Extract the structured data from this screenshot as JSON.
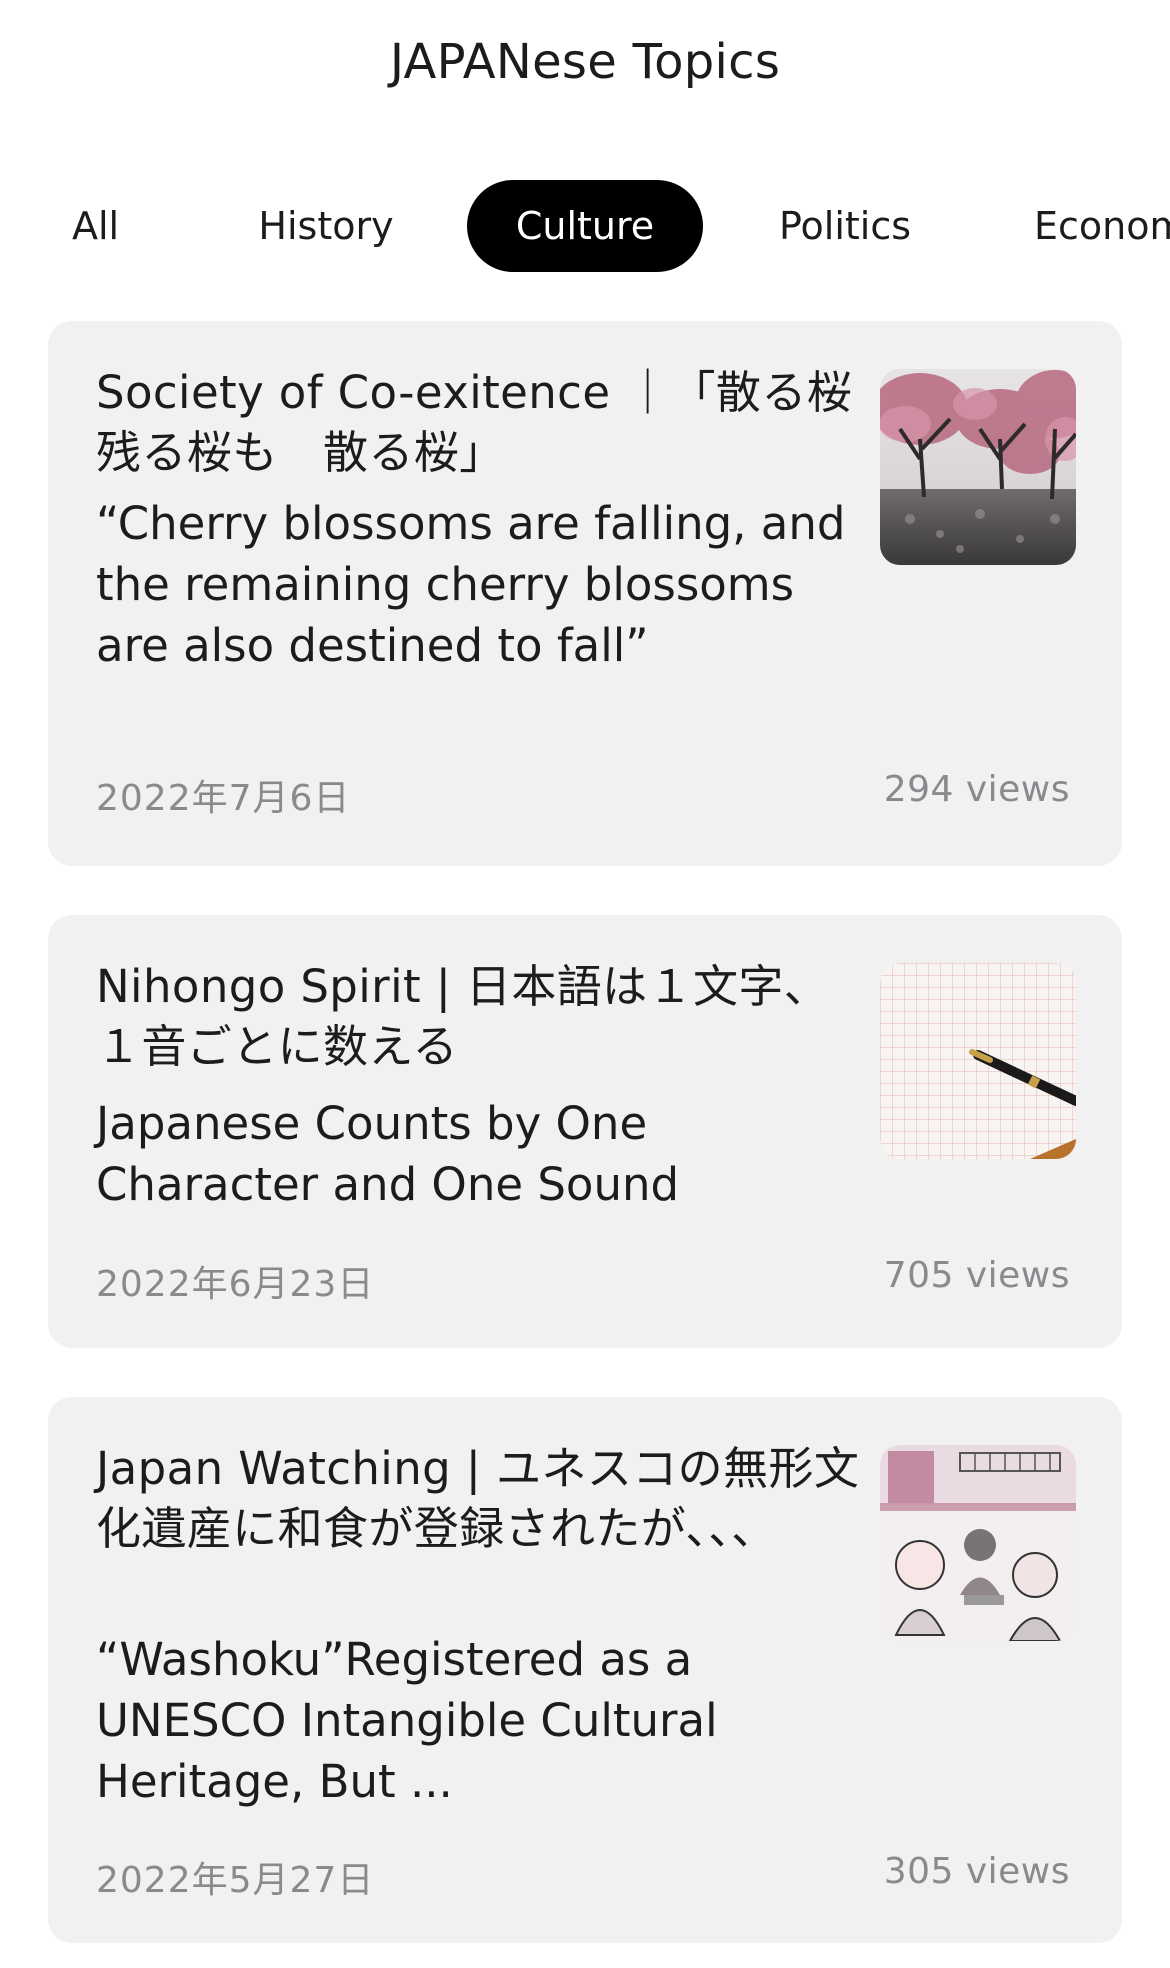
{
  "header": {
    "title": "JAPANese Topics"
  },
  "tabs": [
    {
      "label": "All",
      "active": false
    },
    {
      "label": "History",
      "active": false
    },
    {
      "label": "Culture",
      "active": true
    },
    {
      "label": "Politics",
      "active": false
    },
    {
      "label": "Economy",
      "active": false
    }
  ],
  "articles": [
    {
      "title": "Society of Co-exitence ｜「散る桜　残る桜も　散る桜」",
      "subtitle": "“Cherry blossoms are falling, and the remaining cherry blossoms are also destined to fall”",
      "date": "2022年7月6日",
      "views": "294 views",
      "thumbnail_icon": "cherry-blossom-trees-photo"
    },
    {
      "title": "Nihongo Spirit | 日本語は１文字、１音ごとに数える",
      "subtitle": "Japanese Counts by One Character and One Sound",
      "date": "2022年6月23日",
      "views": "705 views",
      "thumbnail_icon": "manuscript-paper-fountain-pen-photo"
    },
    {
      "title": "Japan Watching | ユネスコの無形文化遺産に和食が登録されたが、、、",
      "subtitle": "“Washoku”Registered as a UNESCO Intangible Cultural Heritage, But ...",
      "date": "2022年5月27日",
      "views": "305 views",
      "thumbnail_icon": "restaurant-illustration"
    }
  ],
  "colors": {
    "active_tab_bg": "#000000",
    "card_bg": "#f1f1f2",
    "meta_text": "#8a8a8e"
  }
}
